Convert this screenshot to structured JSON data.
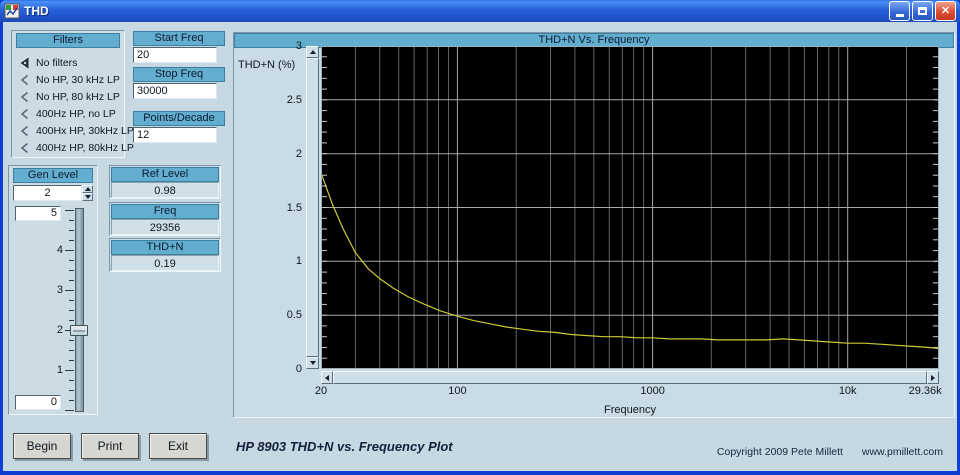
{
  "window": {
    "title": "THD"
  },
  "colors": {
    "header_bg": "#63AECE",
    "panel_bg": "#CBDCE5",
    "window_bg": "#C6D8E2",
    "plot_bg": "#000000",
    "grid_major": "#A8A8A8",
    "grid_minor": "#636363",
    "trace": "#CBCB35",
    "titlebar_blue": "#2A63DD",
    "close_red": "#DD4F33"
  },
  "filters": {
    "header": "Filters",
    "options": [
      {
        "label": "No filters",
        "selected": true
      },
      {
        "label": "No HP, 30 kHz LP",
        "selected": false
      },
      {
        "label": "No HP, 80 kHz LP",
        "selected": false
      },
      {
        "label": "400Hz HP, no LP",
        "selected": false
      },
      {
        "label": "400Hx HP, 30kHz LP",
        "selected": false
      },
      {
        "label": "400Hz HP, 80kHz LP",
        "selected": false
      }
    ]
  },
  "gen_level": {
    "header": "Gen Level",
    "value": "2",
    "slider": {
      "min": 0,
      "max": 5,
      "value": 2,
      "max_label": "5",
      "min_label": "0",
      "tick_labels": [
        "4",
        "3",
        "2",
        "1"
      ]
    }
  },
  "freq_controls": [
    {
      "header": "Start Freq",
      "value": "20"
    },
    {
      "header": "Stop Freq",
      "value": "30000"
    },
    {
      "header": "Points/Decade",
      "value": "12"
    }
  ],
  "indicators": [
    {
      "header": "Ref Level",
      "value": "0.98"
    },
    {
      "header": "Freq",
      "value": "29356"
    },
    {
      "header": "THD+N",
      "value": "0.19"
    }
  ],
  "chart_data": {
    "type": "line",
    "title": "THD+N Vs. Frequency",
    "xlabel": "Frequency",
    "ylabel": "THD+N (%)",
    "x_scale": "log",
    "xlim": [
      20,
      29360
    ],
    "ylim": [
      0,
      3
    ],
    "grid": true,
    "legend": "none",
    "x_ticks": [
      {
        "value": 20,
        "label": "20",
        "align": "center"
      },
      {
        "value": 100,
        "label": "100",
        "align": "center"
      },
      {
        "value": 1000,
        "label": "1000",
        "align": "center"
      },
      {
        "value": 10000,
        "label": "10k",
        "align": "center"
      },
      {
        "value": 29360,
        "label": "29.36k",
        "align": "right"
      }
    ],
    "y_ticks": [
      {
        "value": 0,
        "label": "0"
      },
      {
        "value": 0.5,
        "label": "0.5"
      },
      {
        "value": 1,
        "label": "1"
      },
      {
        "value": 1.5,
        "label": "1.5"
      },
      {
        "value": 2,
        "label": "2"
      },
      {
        "value": 2.5,
        "label": "2.5"
      },
      {
        "value": 3,
        "label": "3"
      }
    ],
    "series": [
      {
        "name": "THD+N",
        "color": "#CBCB35",
        "points": [
          [
            20,
            1.82
          ],
          [
            23,
            1.52
          ],
          [
            26,
            1.3
          ],
          [
            30,
            1.08
          ],
          [
            35,
            0.93
          ],
          [
            40,
            0.84
          ],
          [
            47,
            0.75
          ],
          [
            56,
            0.67
          ],
          [
            68,
            0.6
          ],
          [
            82,
            0.54
          ],
          [
            100,
            0.49
          ],
          [
            121,
            0.45
          ],
          [
            147,
            0.42
          ],
          [
            178,
            0.39
          ],
          [
            215,
            0.37
          ],
          [
            261,
            0.35
          ],
          [
            316,
            0.34
          ],
          [
            383,
            0.32
          ],
          [
            464,
            0.31
          ],
          [
            562,
            0.3
          ],
          [
            681,
            0.3
          ],
          [
            825,
            0.29
          ],
          [
            1000,
            0.29
          ],
          [
            1211,
            0.28
          ],
          [
            1468,
            0.28
          ],
          [
            1778,
            0.28
          ],
          [
            2154,
            0.27
          ],
          [
            2610,
            0.27
          ],
          [
            3162,
            0.27
          ],
          [
            3831,
            0.27
          ],
          [
            4642,
            0.28
          ],
          [
            5623,
            0.27
          ],
          [
            6813,
            0.26
          ],
          [
            8254,
            0.25
          ],
          [
            10000,
            0.24
          ],
          [
            12115,
            0.24
          ],
          [
            14678,
            0.23
          ],
          [
            17783,
            0.22
          ],
          [
            21544,
            0.21
          ],
          [
            26102,
            0.2
          ],
          [
            29360,
            0.19
          ]
        ]
      }
    ]
  },
  "buttons": [
    {
      "label": "Begin"
    },
    {
      "label": "Print"
    },
    {
      "label": "Exit"
    }
  ],
  "footer": {
    "caption": "HP 8903 THD+N vs. Frequency Plot",
    "copyright": "Copyright 2009 Pete Millett",
    "website": "www.pmillett.com"
  }
}
